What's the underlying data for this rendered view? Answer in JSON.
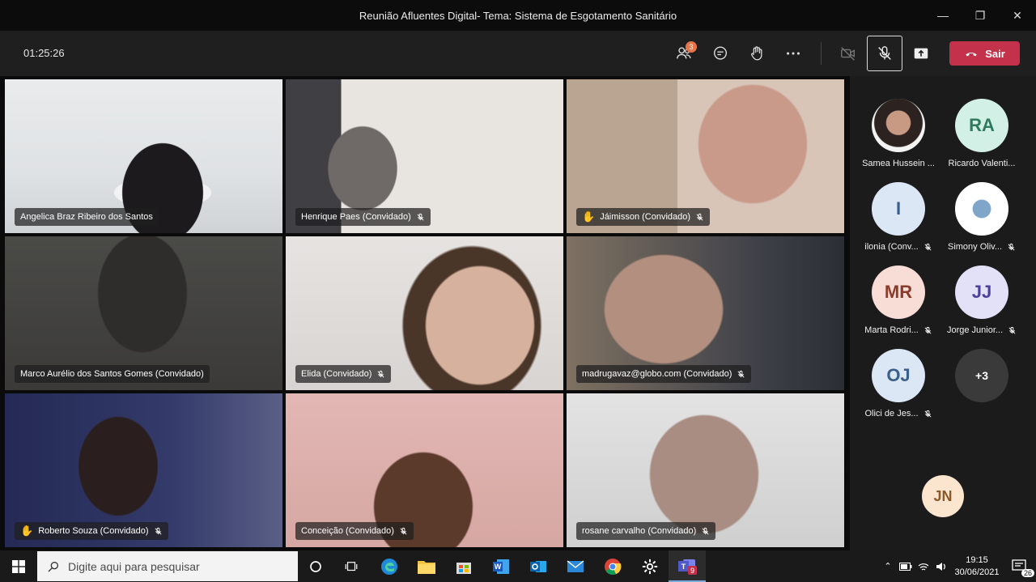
{
  "window": {
    "title": "Reunião Afluentes Digital- Tema: Sistema de Esgotamento Sanitário"
  },
  "toolbar": {
    "timer": "01:25:26",
    "participants_badge": "3",
    "leave_label": "Sair"
  },
  "tiles": [
    {
      "name": "Angelica Braz Ribeiro dos Santos",
      "muted": false,
      "hand": false
    },
    {
      "name": "Henrique Paes (Convidado)",
      "muted": true,
      "hand": false
    },
    {
      "name": "Jáimisson (Convidado)",
      "muted": true,
      "hand": true
    },
    {
      "name": "Marco Aurélio dos Santos Gomes (Convidado)",
      "muted": false,
      "hand": false
    },
    {
      "name": "Elida (Convidado)",
      "muted": true,
      "hand": false
    },
    {
      "name": "madrugavaz@globo.com (Convidado)",
      "muted": true,
      "hand": false
    },
    {
      "name": "Roberto Souza (Convidado)",
      "muted": true,
      "hand": true
    },
    {
      "name": "Conceição (Convidado)",
      "muted": true,
      "hand": false
    },
    {
      "name": "rosane carvalho (Convidado)",
      "muted": true,
      "hand": false
    }
  ],
  "roster": [
    {
      "initials": "",
      "name": "Samea Hussein ...",
      "muted": false,
      "color": "#ffffff"
    },
    {
      "initials": "RA",
      "name": "Ricardo Valenti...",
      "muted": false,
      "color": "#d3f0e6"
    },
    {
      "initials": "I",
      "name": "ilonia (Conv...",
      "muted": true,
      "color": "#dbe7f5"
    },
    {
      "initials": "",
      "name": "Simony Oliv...",
      "muted": true,
      "color": "#ffffff"
    },
    {
      "initials": "MR",
      "name": "Marta Rodri...",
      "muted": true,
      "color": "#f7ddd6"
    },
    {
      "initials": "JJ",
      "name": "Jorge Junior...",
      "muted": true,
      "color": "#e3e1f7"
    },
    {
      "initials": "OJ",
      "name": "Olici de Jes...",
      "muted": true,
      "color": "#dbe7f5"
    },
    {
      "initials": "+3",
      "name": "",
      "muted": false,
      "color": "#3a3a3a"
    }
  ],
  "self_preview": {
    "initials": "JN",
    "color": "#fbe5cf"
  },
  "taskbar": {
    "search_placeholder": "Digite aqui para pesquisar",
    "time": "19:15",
    "date": "30/06/2021",
    "notifications": "26",
    "teams_badge": "9"
  }
}
